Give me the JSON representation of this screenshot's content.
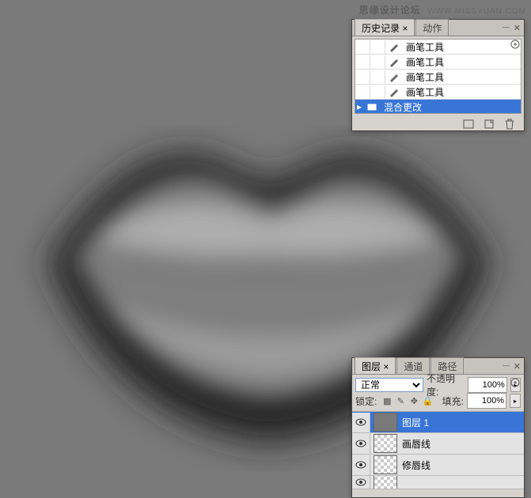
{
  "watermark": {
    "cn": "思缘设计论坛",
    "en": "WWW.MISSYUAN.COM"
  },
  "history": {
    "tabs": {
      "history": "历史记录",
      "actions": "动作"
    },
    "items": [
      {
        "label": "画笔工具",
        "icon": "brush"
      },
      {
        "label": "画笔工具",
        "icon": "brush"
      },
      {
        "label": "画笔工具",
        "icon": "brush"
      },
      {
        "label": "画笔工具",
        "icon": "brush"
      },
      {
        "label": "混合更改",
        "icon": "blend",
        "selected": true
      }
    ]
  },
  "layers": {
    "tabs": {
      "layers": "图层",
      "channels": "通道",
      "paths": "路径"
    },
    "blendMode": "正常",
    "opacityLabel": "不透明度:",
    "opacityValue": "100%",
    "lockLabel": "锁定:",
    "fillLabel": "填充:",
    "fillValue": "100%",
    "items": [
      {
        "name": "图层 1",
        "thumb": "gray",
        "selected": true
      },
      {
        "name": "画唇线",
        "thumb": "checker"
      },
      {
        "name": "修唇线",
        "thumb": "checker"
      },
      {
        "name": "",
        "thumb": "checker"
      }
    ]
  }
}
